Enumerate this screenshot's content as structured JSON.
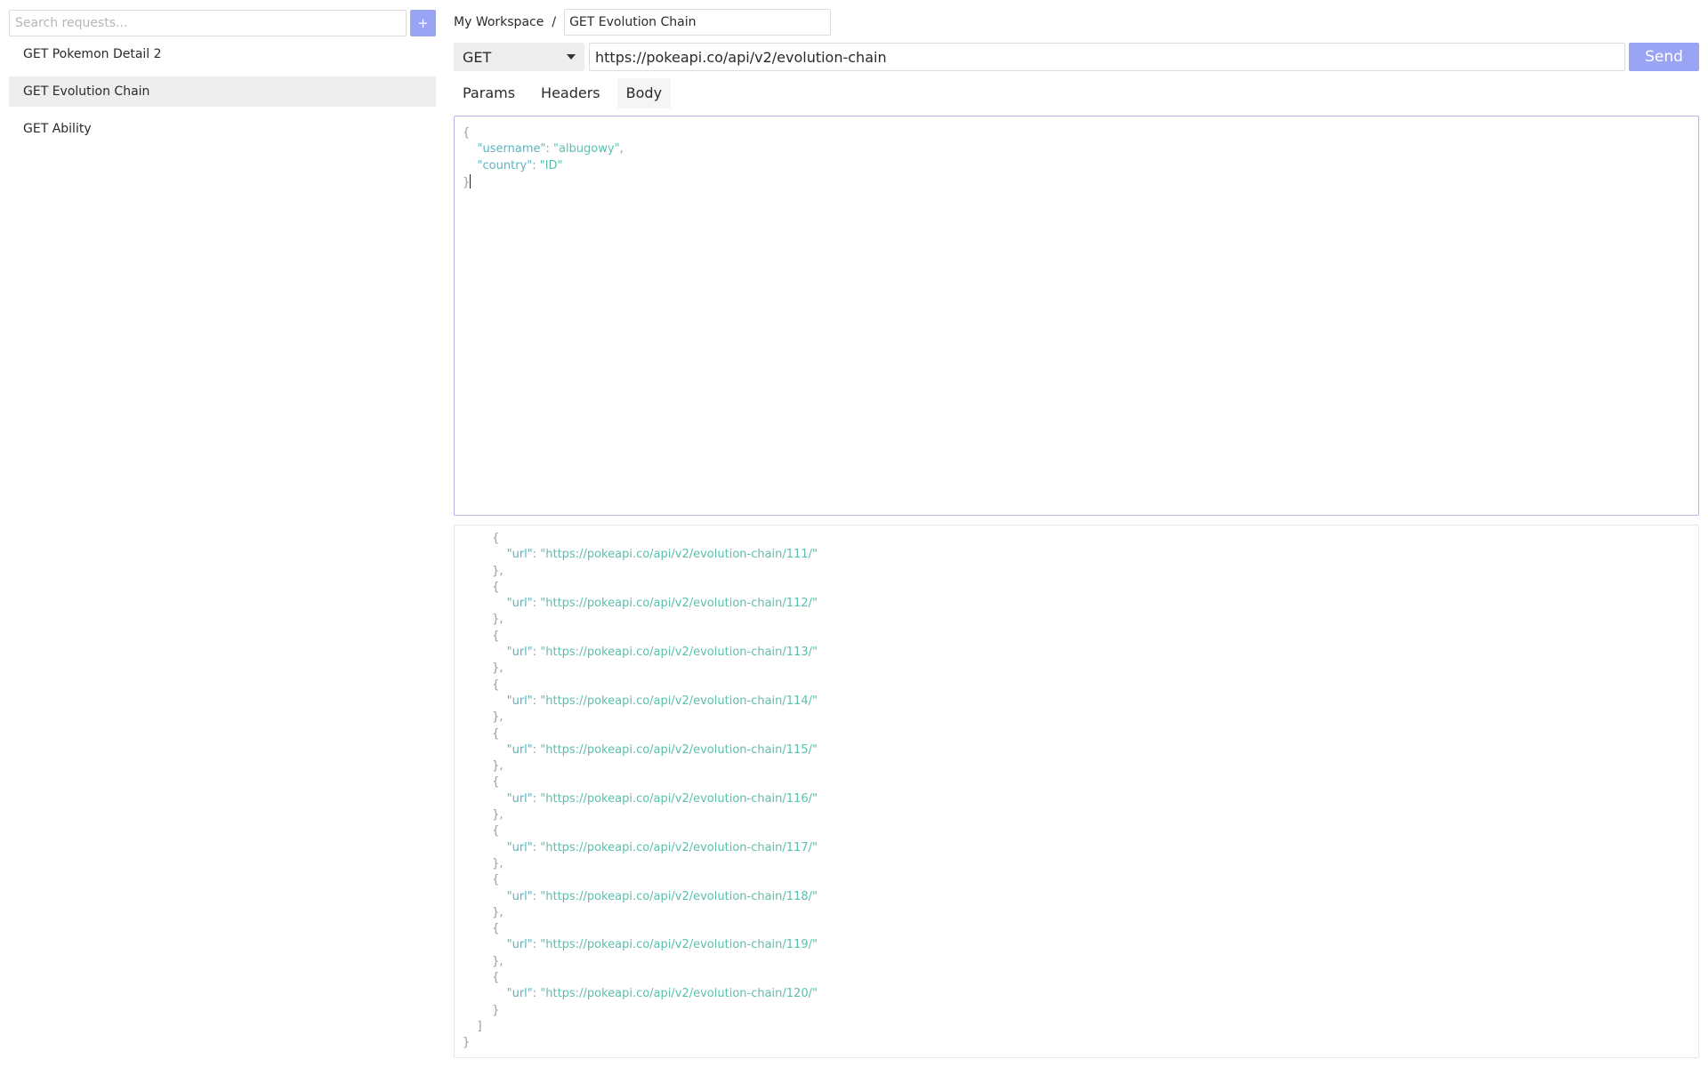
{
  "sidebar": {
    "search_placeholder": "Search requests...",
    "add_label": "+",
    "items": [
      {
        "label": "GET Pokemon Detail 2",
        "active": false
      },
      {
        "label": "GET Evolution Chain",
        "active": true
      },
      {
        "label": "GET Ability",
        "active": false
      }
    ]
  },
  "header": {
    "workspace": "My Workspace",
    "separator": "/",
    "request_name": "GET Evolution Chain"
  },
  "request": {
    "method": "GET",
    "url": "https://pokeapi.co/api/v2/evolution-chain",
    "send_label": "Send"
  },
  "tabs": [
    {
      "label": "Params",
      "active": false
    },
    {
      "label": "Headers",
      "active": false
    },
    {
      "label": "Body",
      "active": true
    }
  ],
  "body_editor": {
    "open_brace": "{",
    "close_brace": "}",
    "fields": [
      {
        "key": "\"username\"",
        "value": "\"albugowy\"",
        "trail": ","
      },
      {
        "key": "\"country\"",
        "value": "\"ID\"",
        "trail": ""
      }
    ]
  },
  "response": {
    "item_key": "\"url\"",
    "open_brace": "{",
    "close_brace": "}",
    "close_brace_comma": "},",
    "array_close": "]",
    "root_close": "}",
    "urls": [
      "\"https://pokeapi.co/api/v2/evolution-chain/111/\"",
      "\"https://pokeapi.co/api/v2/evolution-chain/112/\"",
      "\"https://pokeapi.co/api/v2/evolution-chain/113/\"",
      "\"https://pokeapi.co/api/v2/evolution-chain/114/\"",
      "\"https://pokeapi.co/api/v2/evolution-chain/115/\"",
      "\"https://pokeapi.co/api/v2/evolution-chain/116/\"",
      "\"https://pokeapi.co/api/v2/evolution-chain/117/\"",
      "\"https://pokeapi.co/api/v2/evolution-chain/118/\"",
      "\"https://pokeapi.co/api/v2/evolution-chain/119/\"",
      "\"https://pokeapi.co/api/v2/evolution-chain/120/\""
    ]
  },
  "colors": {
    "accent": "#9aa4f4",
    "json_key": "#5bb3bd",
    "json_string": "#5bbfab",
    "active_item_bg": "#eeeeee"
  }
}
